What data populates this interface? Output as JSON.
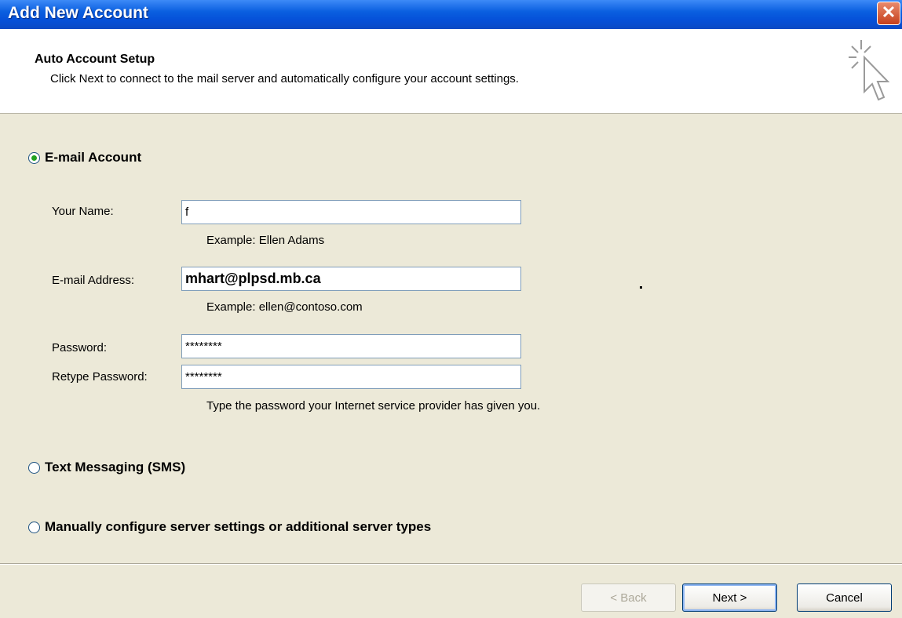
{
  "window": {
    "title": "Add New Account",
    "close_glyph": "✕"
  },
  "header": {
    "title": "Auto Account Setup",
    "subtitle": "Click Next to connect to the mail server and automatically configure your account settings.",
    "icon": "wizard-cursor-icon"
  },
  "options": {
    "email_account": {
      "label": "E-mail Account",
      "selected": true
    },
    "text_messaging": {
      "label": "Text Messaging (SMS)",
      "selected": false
    },
    "manual": {
      "label": "Manually configure server settings or additional server types",
      "selected": false
    }
  },
  "form": {
    "name": {
      "label": "Your Name:",
      "value": "f",
      "example": "Example: Ellen Adams"
    },
    "email": {
      "label": "E-mail Address:",
      "value": "mhart@plpsd.mb.ca",
      "example": "Example: ellen@contoso.com"
    },
    "password": {
      "label": "Password:",
      "value": "********"
    },
    "retype_password": {
      "label": "Retype Password:",
      "value": "********"
    },
    "password_hint": "Type the password your Internet service provider has given you."
  },
  "buttons": {
    "back": "< Back",
    "next": "Next >",
    "cancel": "Cancel"
  },
  "colors": {
    "titlebar": "#0550d8",
    "dialog_bg": "#ece9d8",
    "radio_dot": "#21a121"
  }
}
